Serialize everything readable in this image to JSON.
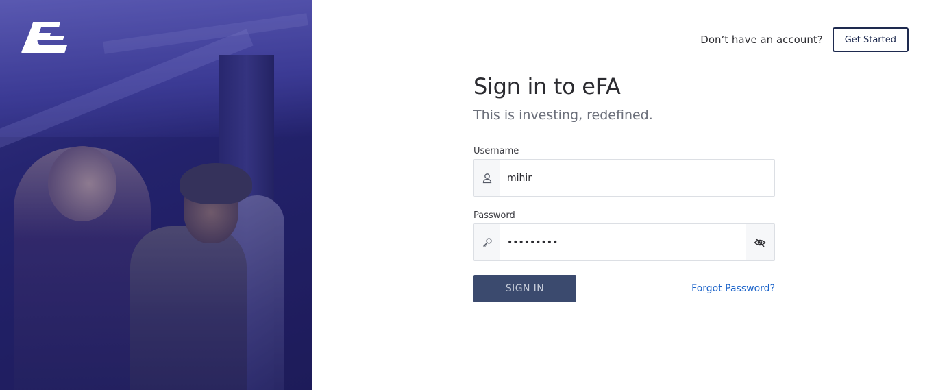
{
  "hero": {
    "logo_icon": "efa-logo-icon",
    "image_description_icon": "hero-photo"
  },
  "topbar": {
    "prompt": "Don’t have an account?",
    "get_started_label": "Get Started"
  },
  "form": {
    "title": "Sign in to eFA",
    "subtitle": "This is investing, redefined.",
    "username": {
      "label": "Username",
      "value": "mihir",
      "icon": "user-icon"
    },
    "password": {
      "label": "Password",
      "value": "•••••••••",
      "icon": "key-icon",
      "toggle_icon": "eye-off-icon"
    },
    "signin_label": "SIGN IN",
    "forgot_label": "Forgot Password?"
  },
  "colors": {
    "primary": "#3b4a6e",
    "link": "#1b63c9",
    "hero_tint": "#2a2a7a",
    "border_dark": "#1e2a4f"
  }
}
